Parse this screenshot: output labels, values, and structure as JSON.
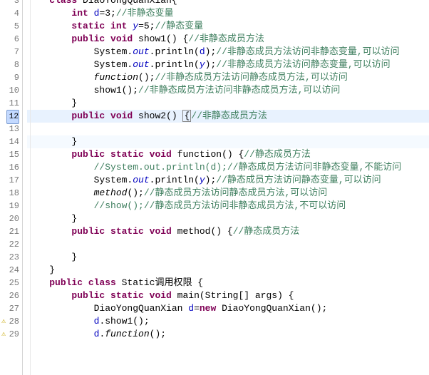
{
  "lines": [
    {
      "n": 3,
      "html": "<span class='kw'>class</span> DiaoYongQuanXian{",
      "ind": 1,
      "top_cut": true
    },
    {
      "n": 4,
      "html": "<span class='kw'>int</span> <span class='field'>d</span>=3;<span class='com'>//非静态变量</span>",
      "ind": 2
    },
    {
      "n": 5,
      "html": "<span class='kw'>static int</span> <span class='sfield'>y</span>=5;<span class='com'>//静态变量</span>",
      "ind": 2
    },
    {
      "n": 6,
      "html": "<span class='kw'>public void</span> show1() {<span class='com'>//非静态成员方法</span>",
      "ind": 2,
      "fold": "-"
    },
    {
      "n": 7,
      "html": "System.<span class='sfield'>out</span>.println(<span class='field'>d</span>);<span class='com'>//非静态成员方法访问非静态变量,可以访问</span>",
      "ind": 3
    },
    {
      "n": 8,
      "html": "System.<span class='sfield'>out</span>.println(<span class='sfield'>y</span>);<span class='com'>//非静态成员方法访问静态变量,可以访问</span>",
      "ind": 3
    },
    {
      "n": 9,
      "html": "<span class='method-italic'>function</span>();<span class='com'>//非静态成员方法访问静态成员方法,可以访问</span>",
      "ind": 3
    },
    {
      "n": 10,
      "html": "show1();<span class='com'>//非静态成员方法访问非静态成员方法,可以访问</span>",
      "ind": 3
    },
    {
      "n": 11,
      "html": "}",
      "ind": 2
    },
    {
      "n": 12,
      "html": "<span class='kw'>public void</span> show2() <span class='box-highlight'>{</span><span class='com'>//非静态成员方法</span>",
      "ind": 2,
      "fold": "-",
      "sel": true
    },
    {
      "n": 13,
      "html": "",
      "ind": 3
    },
    {
      "n": 14,
      "html": "}",
      "ind": 2,
      "hl": true
    },
    {
      "n": 15,
      "html": "<span class='kw'>public static void</span> function() {<span class='com'>//静态成员方法</span>",
      "ind": 2,
      "fold": "-"
    },
    {
      "n": 16,
      "html": "<span class='com'>//System.out.println(d);//静态成员方法访问非静态变量,不能访问</span>",
      "ind": 3
    },
    {
      "n": 17,
      "html": "System.<span class='sfield'>out</span>.println(<span class='sfield'>y</span>);<span class='com'>//静态成员方法访问静态变量,可以访问</span>",
      "ind": 3
    },
    {
      "n": 18,
      "html": "<span class='method-italic'>method</span>();<span class='com'>//静态成员方法访问静态成员方法,可以访问</span>",
      "ind": 3
    },
    {
      "n": 19,
      "html": "<span class='com'>//show();//静态成员方法访问非静态成员方法,不可以访问</span>",
      "ind": 3
    },
    {
      "n": 20,
      "html": "}",
      "ind": 2
    },
    {
      "n": 21,
      "html": "<span class='kw'>public static void</span> method() {<span class='com'>//静态成员方法</span>",
      "ind": 2,
      "fold": "-"
    },
    {
      "n": 22,
      "html": "",
      "ind": 3
    },
    {
      "n": 23,
      "html": "}",
      "ind": 2
    },
    {
      "n": 24,
      "html": "}",
      "ind": 1
    },
    {
      "n": 25,
      "html": "<span class='kw'>public class</span> Static调用权限 {",
      "ind": 1
    },
    {
      "n": 26,
      "html": "<span class='kw'>public static void</span> main(String[] args) {",
      "ind": 2,
      "fold": "-"
    },
    {
      "n": 27,
      "html": "DiaoYongQuanXian <span class='field'>d</span>=<span class='kw'>new</span> DiaoYongQuanXian();",
      "ind": 3
    },
    {
      "n": 28,
      "html": "<span class='field'>d</span>.show1();",
      "ind": 3,
      "warn": true
    },
    {
      "n": 29,
      "html": "<span class='field'>d</span>.<span class='method-italic'>function</span>();",
      "ind": 3,
      "warn": true
    }
  ],
  "indent_unit": "    "
}
